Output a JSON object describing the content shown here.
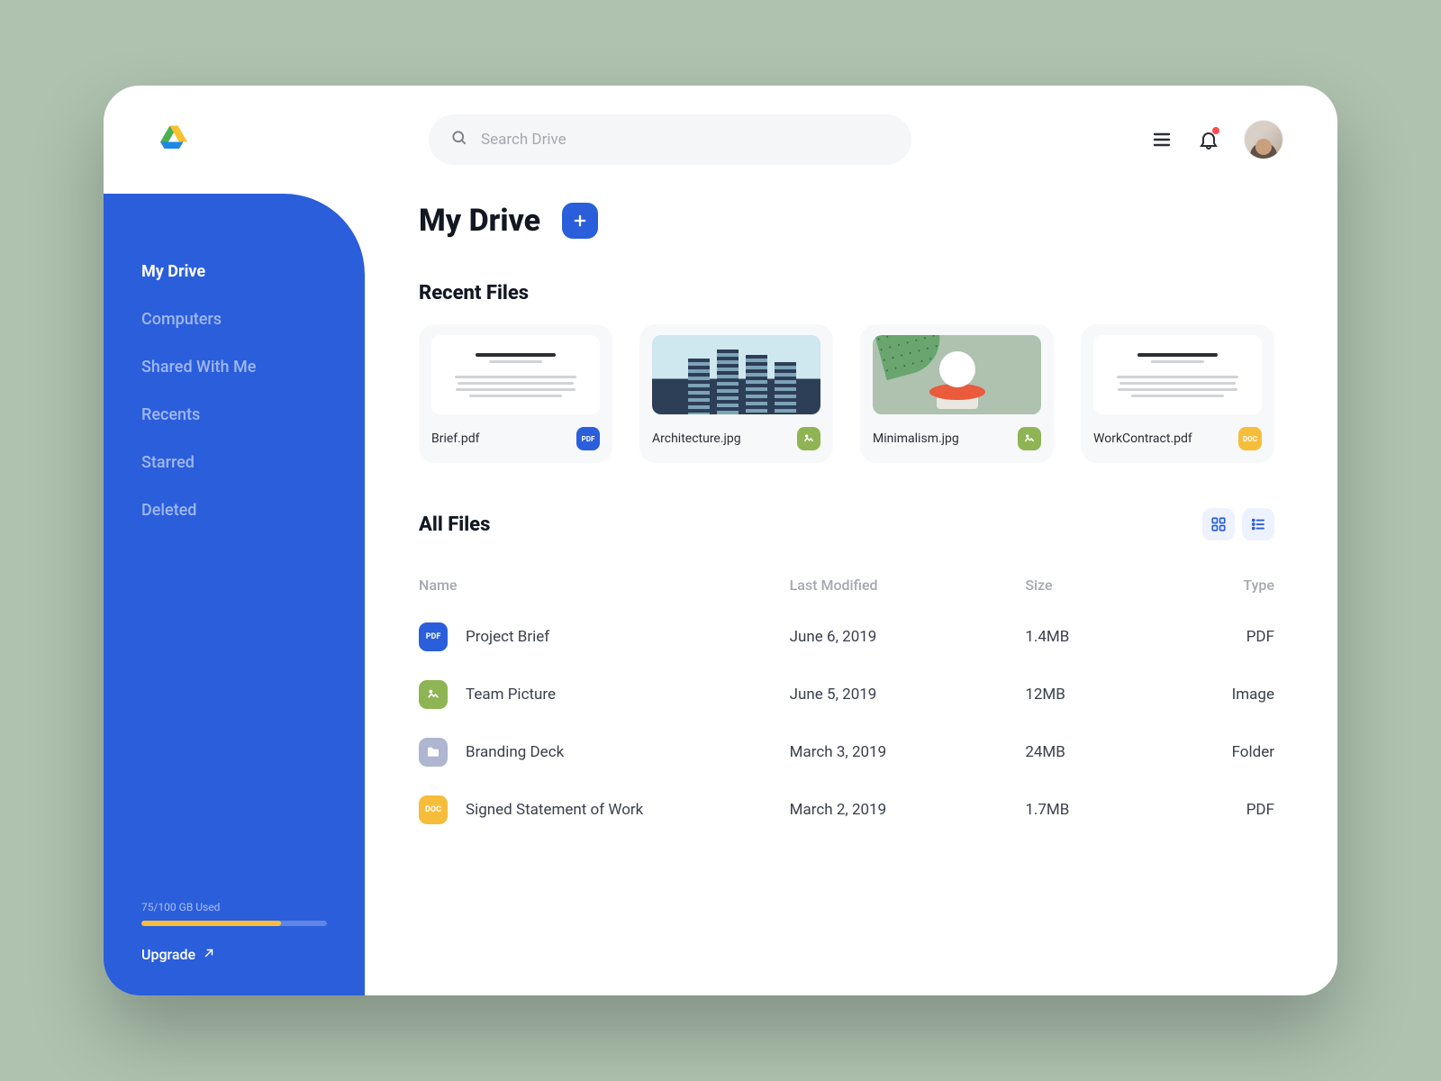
{
  "search": {
    "placeholder": "Search Drive"
  },
  "sidebar": {
    "items": [
      {
        "label": "My Drive",
        "active": true
      },
      {
        "label": "Computers"
      },
      {
        "label": "Shared With Me"
      },
      {
        "label": "Recents"
      },
      {
        "label": "Starred"
      },
      {
        "label": "Deleted"
      }
    ],
    "storage": {
      "label": "75/100 GB Used",
      "percent": 75
    },
    "upgrade": "Upgrade"
  },
  "page": {
    "title": "My Drive",
    "recent_title": "Recent Files",
    "allfiles_title": "All Files"
  },
  "recent": [
    {
      "name": "Brief.pdf",
      "type": "pdf",
      "badge": "PDF"
    },
    {
      "name": "Architecture.jpg",
      "type": "img",
      "badge": ""
    },
    {
      "name": "Minimalism.jpg",
      "type": "img",
      "badge": ""
    },
    {
      "name": "WorkContract.pdf",
      "type": "doc",
      "badge": "DOC"
    }
  ],
  "columns": {
    "name": "Name",
    "modified": "Last Modified",
    "size": "Size",
    "type": "Type"
  },
  "files": [
    {
      "name": "Project Brief",
      "modified": "June 6, 2019",
      "size": "1.4MB",
      "type": "PDF",
      "icon": "pdf",
      "badge": "PDF"
    },
    {
      "name": "Team Picture",
      "modified": "June 5, 2019",
      "size": "12MB",
      "type": "Image",
      "icon": "img",
      "badge": ""
    },
    {
      "name": "Branding Deck",
      "modified": "March 3, 2019",
      "size": "24MB",
      "type": "Folder",
      "icon": "fld",
      "badge": ""
    },
    {
      "name": "Signed Statement of Work",
      "modified": "March 2, 2019",
      "size": "1.7MB",
      "type": "PDF",
      "icon": "doc",
      "badge": "DOC"
    }
  ],
  "colors": {
    "accent": "#2a5edb",
    "yellow": "#f6bd3b",
    "green": "#8eb454"
  }
}
